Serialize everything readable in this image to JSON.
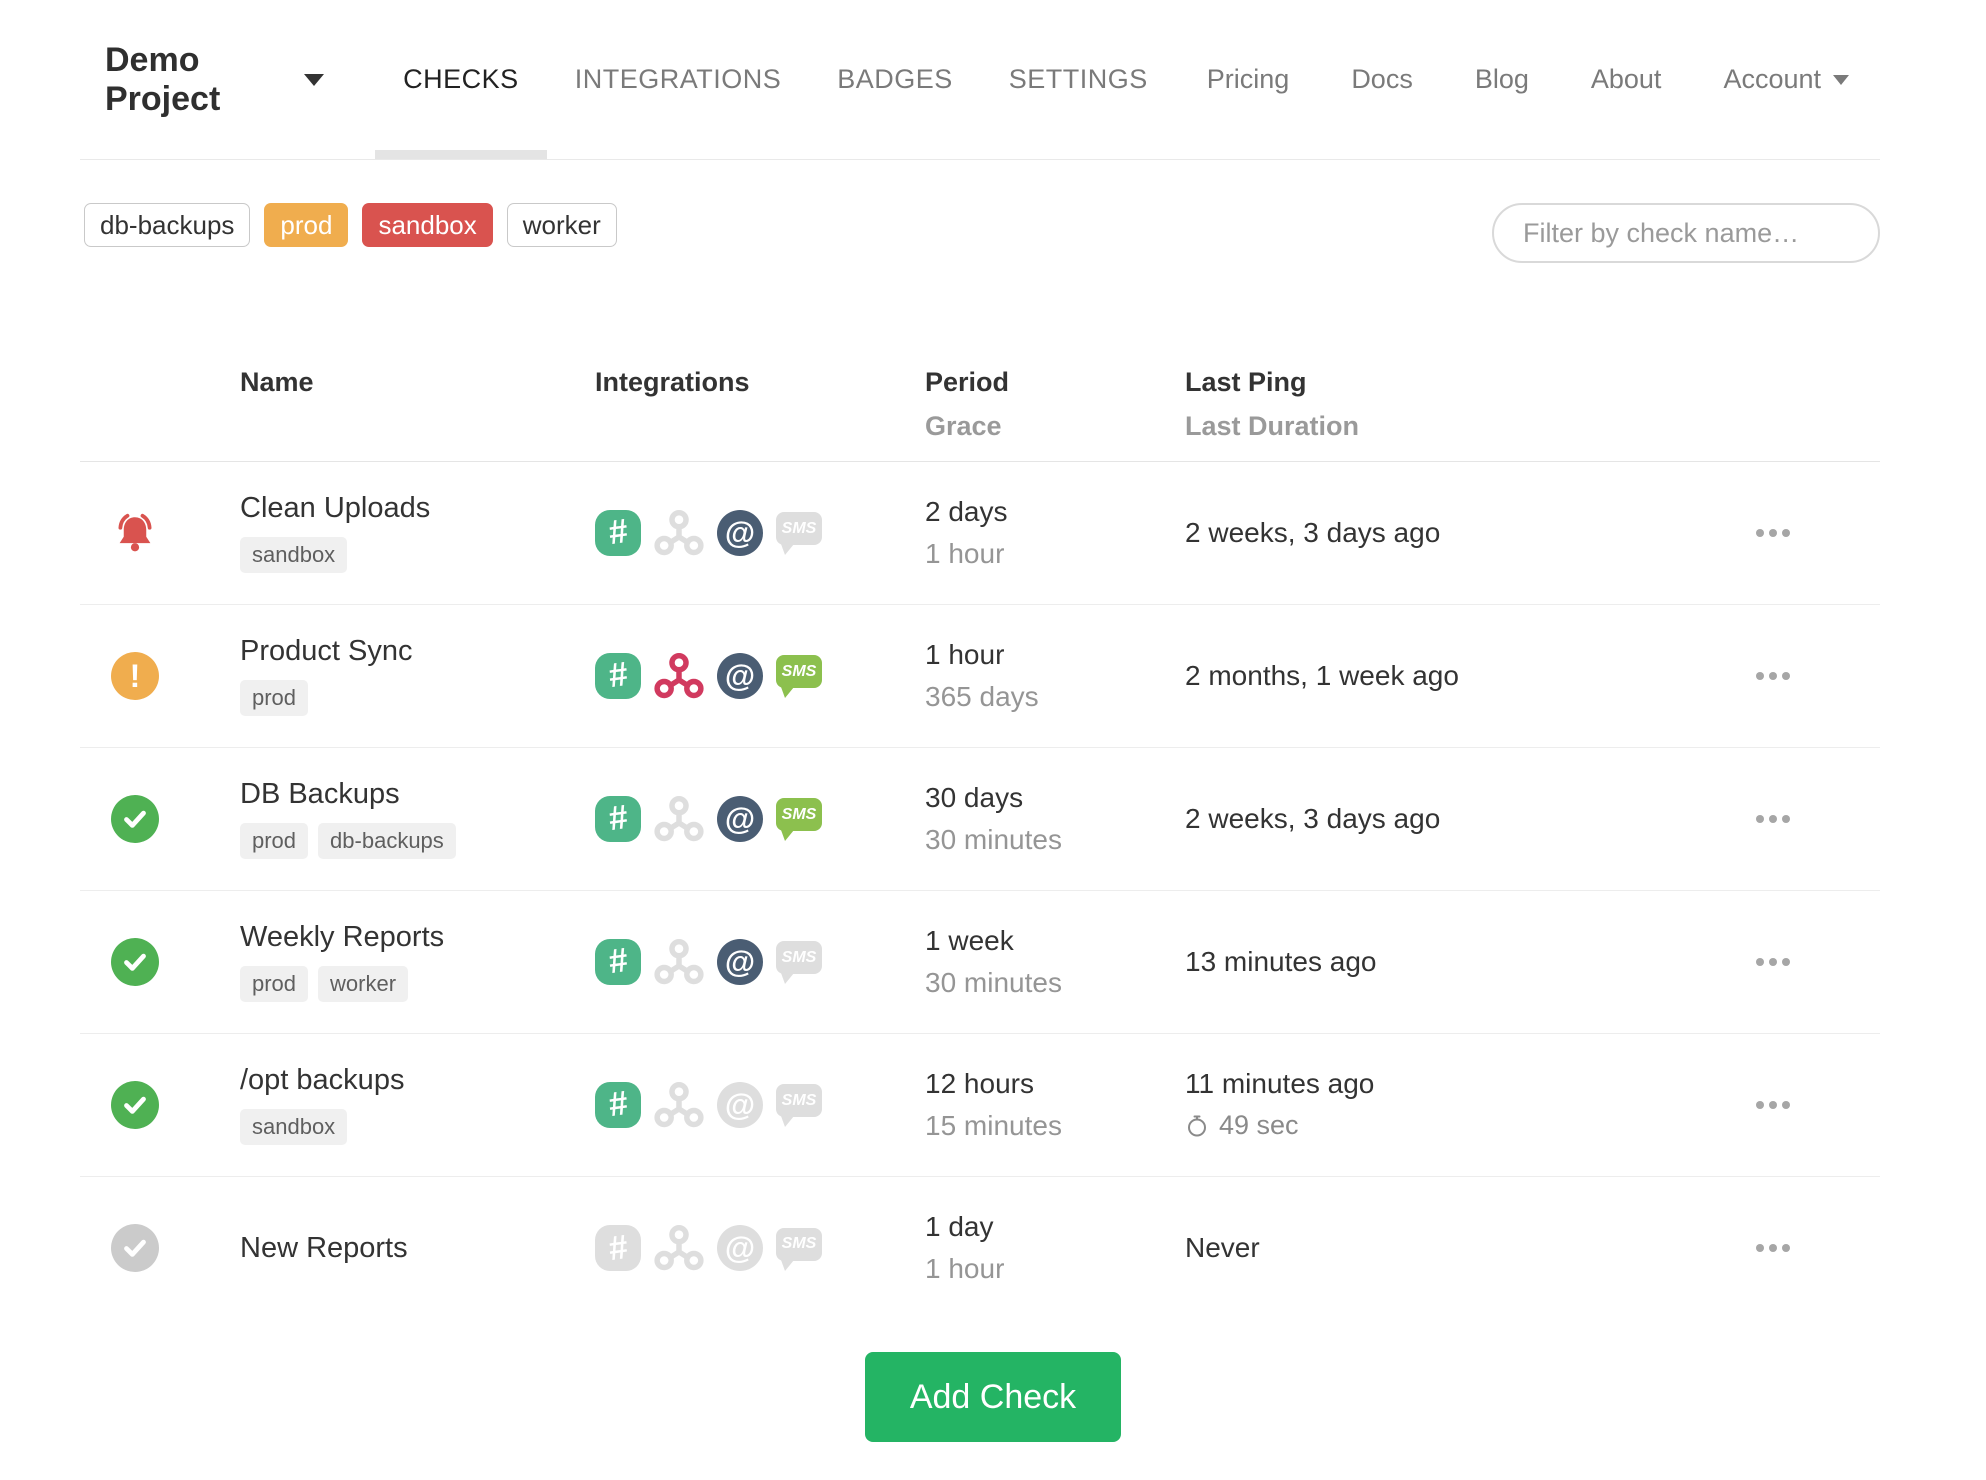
{
  "nav": {
    "project_name": "Demo Project",
    "tabs": [
      {
        "label": "CHECKS",
        "active": true
      },
      {
        "label": "INTEGRATIONS",
        "active": false
      },
      {
        "label": "BADGES",
        "active": false
      },
      {
        "label": "SETTINGS",
        "active": false
      }
    ],
    "links": [
      {
        "label": "Pricing"
      },
      {
        "label": "Docs"
      },
      {
        "label": "Blog"
      },
      {
        "label": "About"
      }
    ],
    "account_label": "Account"
  },
  "filter_bar": {
    "tag_buttons": [
      {
        "label": "db-backups",
        "variant": "outline"
      },
      {
        "label": "prod",
        "variant": "warning"
      },
      {
        "label": "sandbox",
        "variant": "danger"
      },
      {
        "label": "worker",
        "variant": "outline"
      }
    ],
    "search_placeholder": "Filter by check name…"
  },
  "table": {
    "headers": {
      "name": "Name",
      "integrations": "Integrations",
      "period": "Period",
      "grace": "Grace",
      "last_ping": "Last Ping",
      "last_duration": "Last Duration"
    },
    "rows": [
      {
        "status": "down",
        "name": "Clean Uploads",
        "tags": [
          "sandbox"
        ],
        "integrations": {
          "slack": true,
          "webhook": false,
          "email": true,
          "sms": false
        },
        "period": "2 days",
        "grace": "1 hour",
        "last_ping": "2 weeks, 3 days ago",
        "last_duration": null
      },
      {
        "status": "grace",
        "name": "Product Sync",
        "tags": [
          "prod"
        ],
        "integrations": {
          "slack": true,
          "webhook": true,
          "email": true,
          "sms": true
        },
        "period": "1 hour",
        "grace": "365 days",
        "last_ping": "2 months, 1 week ago",
        "last_duration": null
      },
      {
        "status": "up",
        "name": "DB Backups",
        "tags": [
          "prod",
          "db-backups"
        ],
        "integrations": {
          "slack": true,
          "webhook": false,
          "email": true,
          "sms": true
        },
        "period": "30 days",
        "grace": "30 minutes",
        "last_ping": "2 weeks, 3 days ago",
        "last_duration": null
      },
      {
        "status": "up",
        "name": "Weekly Reports",
        "tags": [
          "prod",
          "worker"
        ],
        "integrations": {
          "slack": true,
          "webhook": false,
          "email": true,
          "sms": false
        },
        "period": "1 week",
        "grace": "30 minutes",
        "last_ping": "13 minutes ago",
        "last_duration": null
      },
      {
        "status": "up",
        "name": "/opt backups",
        "tags": [
          "sandbox"
        ],
        "integrations": {
          "slack": true,
          "webhook": false,
          "email": false,
          "sms": false
        },
        "period": "12 hours",
        "grace": "15 minutes",
        "last_ping": "11 minutes ago",
        "last_duration": "49 sec"
      },
      {
        "status": "new",
        "name": "New Reports",
        "tags": [],
        "integrations": {
          "slack": false,
          "webhook": false,
          "email": false,
          "sms": false
        },
        "period": "1 day",
        "grace": "1 hour",
        "last_ping": "Never",
        "last_duration": null
      }
    ]
  },
  "add_check_label": "Add Check",
  "icons": {
    "status_down": "bell-icon",
    "status_grace": "exclamation-icon",
    "status_up": "check-icon",
    "status_new": "check-icon",
    "integration_types": [
      "slack-icon",
      "webhook-icon",
      "email-icon",
      "sms-icon"
    ],
    "last_duration": "stopwatch-icon",
    "row_menu": "ellipsis-icon",
    "dropdown": "caret-down-icon"
  },
  "colors": {
    "accent_green": "#24b464",
    "status_up": "#4fb153",
    "status_new": "#cbcbcb",
    "status_grace": "#f0ad4e",
    "status_down": "#d9534f",
    "tag_warning": "#f0ad4e",
    "tag_danger": "#d9534f",
    "slack": "#4eb588",
    "webhook": "#d13a5f",
    "email": "#4a5d73",
    "sms": "#8cc04e",
    "icon_disabled": "#dedede"
  }
}
